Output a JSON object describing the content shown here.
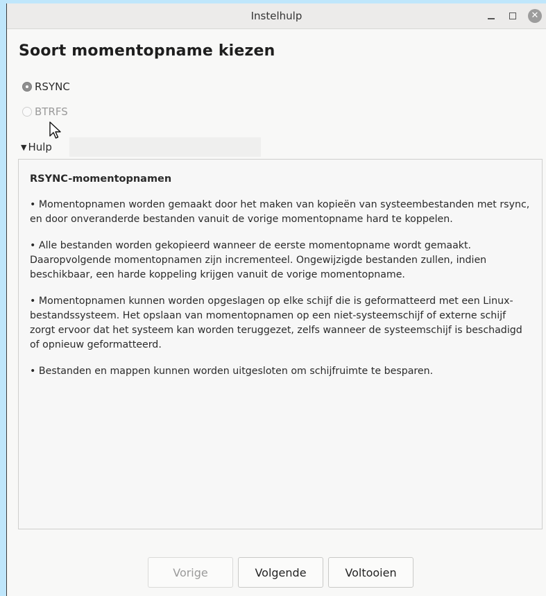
{
  "window": {
    "title": "Instelhulp"
  },
  "page": {
    "heading": "Soort momentopname kiezen"
  },
  "options": [
    {
      "label": "RSYNC",
      "selected": true,
      "enabled": true
    },
    {
      "label": "BTRFS",
      "selected": false,
      "enabled": false
    }
  ],
  "help": {
    "expander_label": "Hulp",
    "title": "RSYNC-momentopnamen",
    "paragraphs": [
      "• Momentopnamen worden gemaakt door het maken van kopieën van systeembestanden met rsync, en door onveranderde bestanden vanuit de vorige momentopname hard te koppelen.",
      "• Alle bestanden worden gekopieerd wanneer de eerste momentopname wordt gemaakt. Daaropvolgende momentopnamen zijn incrementeel. Ongewijzigde bestanden zullen, indien beschikbaar, een harde koppeling krijgen vanuit de vorige momentopname.",
      "• Momentopnamen kunnen worden opgeslagen op elke schijf die is geformatteerd met een Linux-bestandssysteem. Het opslaan van momentopnamen op een niet-systeemschijf of externe schijf zorgt ervoor dat het systeem kan worden teruggezet, zelfs wanneer de systeemschijf is beschadigd of opnieuw geformatteerd.",
      "• Bestanden en mappen kunnen worden uitgesloten om schijfruimte te besparen."
    ]
  },
  "buttons": {
    "previous": "Vorige",
    "next": "Volgende",
    "finish": "Voltooien"
  },
  "icons": {
    "minimize": "minimize-icon",
    "maximize": "maximize-icon",
    "close": "close-icon",
    "expander": "triangle-down-icon",
    "cursor": "mouse-pointer-icon"
  }
}
